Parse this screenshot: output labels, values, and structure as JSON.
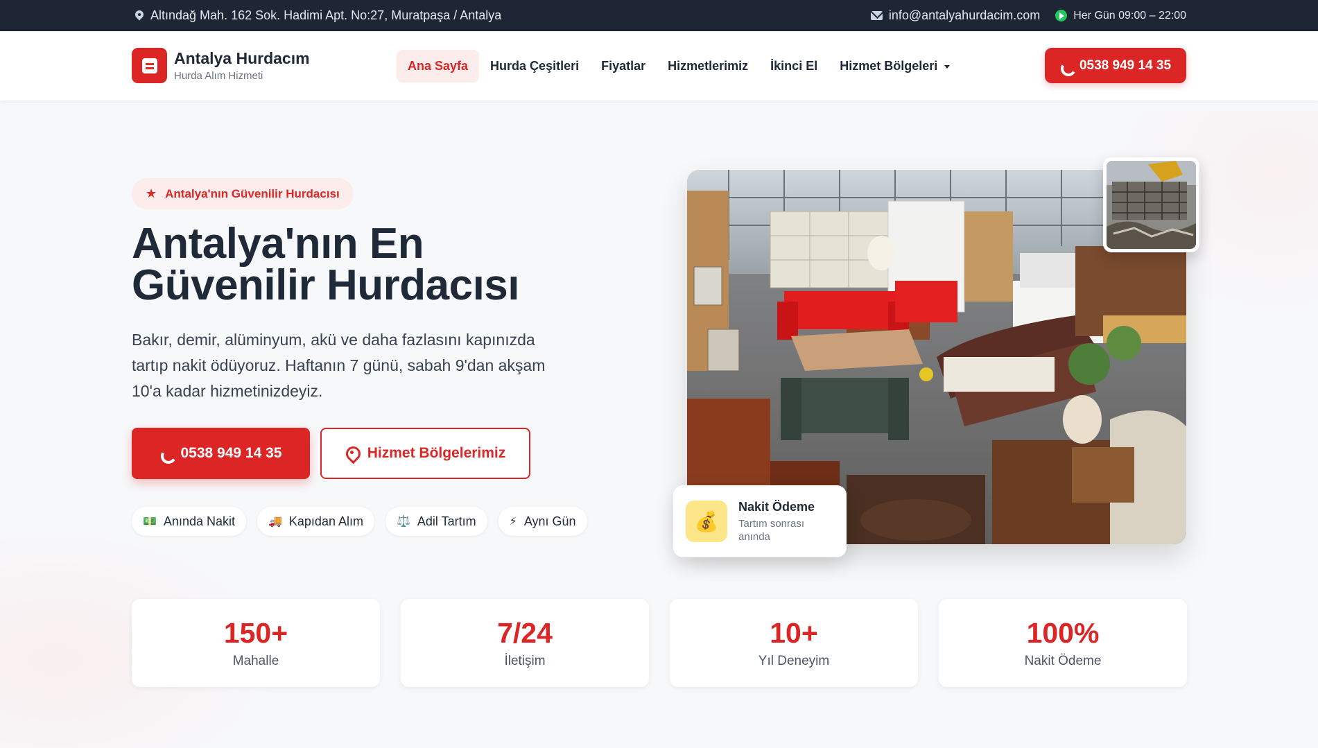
{
  "topbar": {
    "address": "Altındağ Mah. 162 Sok. Hadimi Apt. No:27, Muratpaşa / Antalya",
    "email": "info@antalyahurdacim.com",
    "hours": "Her Gün 09:00 – 22:00"
  },
  "brand": {
    "title": "Antalya Hurdacım",
    "subtitle": "Hurda Alım Hizmeti",
    "accent": "#dc2626"
  },
  "nav": {
    "items": [
      {
        "label": "Ana Sayfa",
        "active": true
      },
      {
        "label": "Hurda Çeşitleri"
      },
      {
        "label": "Fiyatlar"
      },
      {
        "label": "Hizmetlerimiz"
      },
      {
        "label": "İkinci El"
      },
      {
        "label": "Hizmet Bölgeleri",
        "dropdown": true
      }
    ],
    "phone": "0538 949 14 35"
  },
  "hero": {
    "badge": "Antalya'nın Güvenilir Hurdacısı",
    "title_line1": "Antalya'nın En",
    "title_line2": "Güvenilir Hurdacısı",
    "lead": "Bakır, demir, alüminyum, akü ve daha fazlasını kapınızda tartıp nakit ödüyoruz. Haftanın 7 günü, sabah 9'dan akşam 10'a kadar hizmetinizdeyiz.",
    "primary_cta": "0538 949 14 35",
    "secondary_cta": "Hizmet Bölgelerimiz",
    "chips": [
      {
        "icon": "💵",
        "label": "Anında Nakit"
      },
      {
        "icon": "🚚",
        "label": "Kapıdan Alım"
      },
      {
        "icon": "⚖️",
        "label": "Adil Tartım"
      },
      {
        "icon": "⚡",
        "label": "Aynı Gün"
      }
    ]
  },
  "pay_card": {
    "icon": "💰",
    "title": "Nakit Ödeme",
    "subtitle": "Tartım sonrası anında"
  },
  "stats": [
    {
      "value": "150+",
      "label": "Mahalle"
    },
    {
      "value": "7/24",
      "label": "İletişim"
    },
    {
      "value": "10+",
      "label": "Yıl Deneyim"
    },
    {
      "value": "100%",
      "label": "Nakit Ödeme"
    }
  ]
}
